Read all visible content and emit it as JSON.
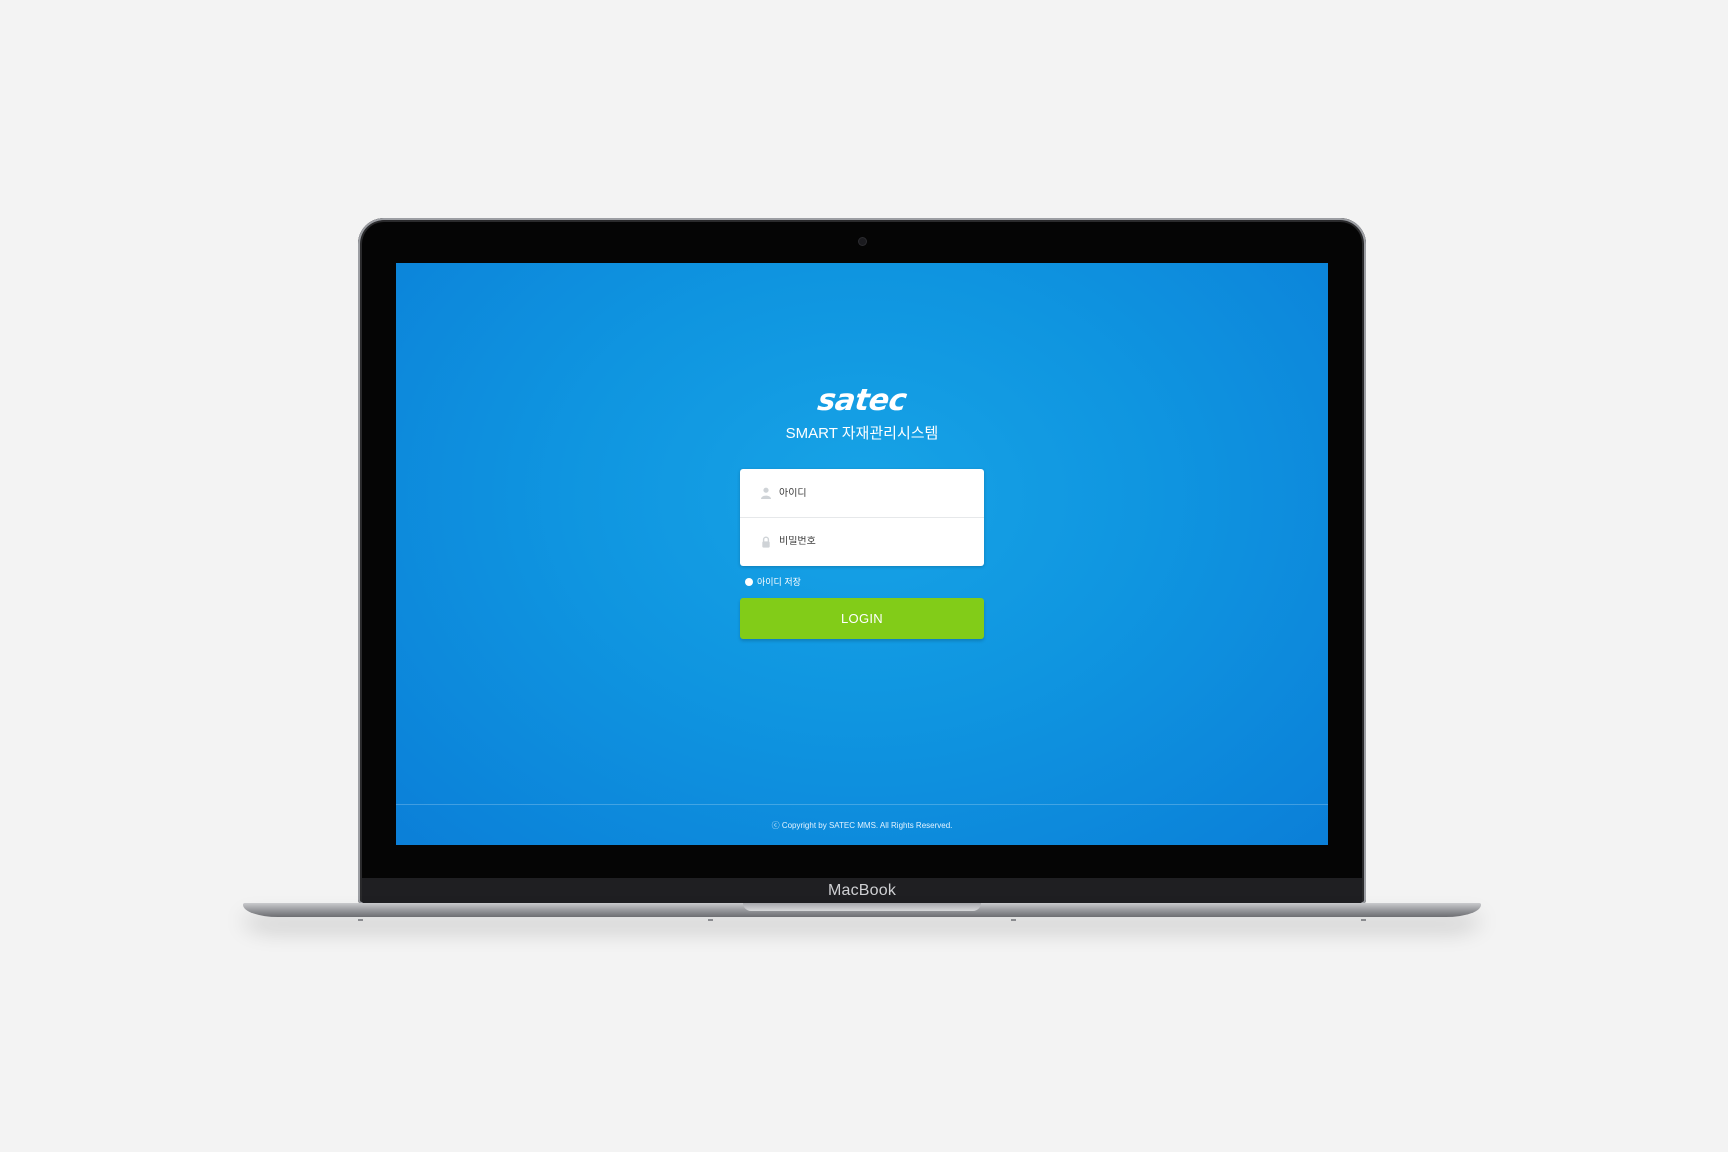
{
  "device": {
    "chin_label": "MacBook"
  },
  "app": {
    "logo": "satec",
    "subtitle": "SMART 자재관리시스템",
    "colors": {
      "background": "#0f95e0",
      "login_button": "#82cc18"
    }
  },
  "login": {
    "id_placeholder": "아이디",
    "id_icon": "user-icon",
    "password_placeholder": "비밀번호",
    "password_icon": "lock-icon",
    "remember_label": "아이디 저장",
    "submit_label": "LOGIN"
  },
  "footer": {
    "copyright": "ⓒ Copyright by SATEC MMS. All Rights Reserved."
  }
}
